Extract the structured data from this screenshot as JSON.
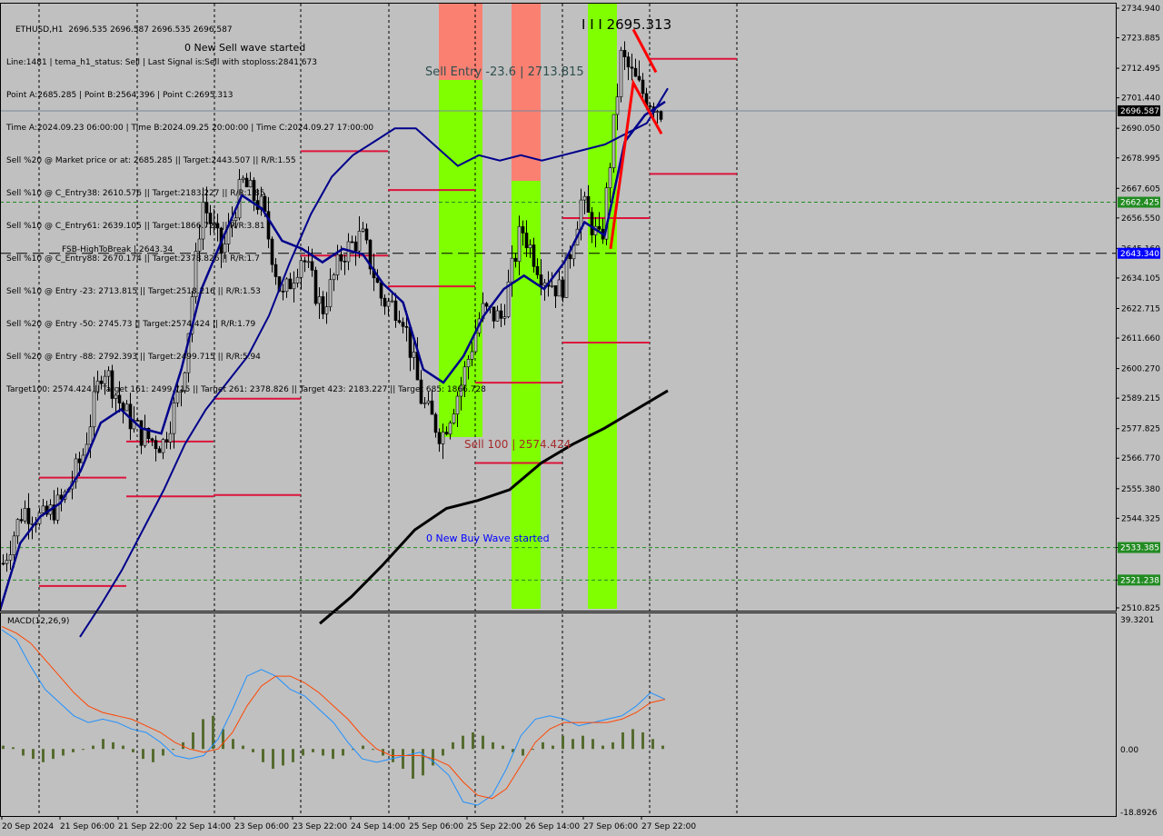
{
  "header": {
    "symbol_line": "ETHUSD,H1  2696.535 2696.587 2696.535 2696.587",
    "info_lines": [
      "Line:1481 | tema_h1_status: Sell | Last Signal is:Sell with stoploss:2841.673",
      "Point A:2685.285 | Point B:2564.396 | Point C:2695.313",
      "Time A:2024.09.23 06:00:00 | Time B:2024.09.25 20:00:00 | Time C:2024.09.27 17:00:00",
      "Sell %20 @ Market price or at: 2685.285 || Target:2443.507 || R/R:1.55",
      "Sell %10 @ C_Entry38: 2610.576 || Target:2183.227 || R/R:1.85",
      "Sell %10 @ C_Entry61: 2639.105 || Target:1866.728 || R/R:3.81",
      "Sell %10 @ C_Entry88: 2670.174 || Target:2378.826 || R/R:1.7",
      "Sell %10 @ Entry -23: 2713.815 || Target:2518.216 || R/R:1.53",
      "Sell %20 @ Entry -50: 2745.73 || Target:2574.424 || R/R:1.79",
      "Sell %20 @ Entry -88: 2792.393 || Target:2499.715 || R/R:5.94",
      "Target100: 2574.424 || Target 161: 2499.715 || Target 261: 2378.826 || Target 423: 2183.227 || Target 685: 1866.728"
    ]
  },
  "annotations": {
    "sell_wave": "0 New Sell wave started",
    "sell_entry": "Sell Entry -23.6 | 2713.815",
    "point_c": "I I I 2695.313",
    "fsb": "FSB-HighToBreak | 2643.34",
    "sell_100": "Sell 100 | 2574.424",
    "buy_wave": "0 New Buy Wave started"
  },
  "colors": {
    "background": "#c0c0c0",
    "sell_zone": "#fa8072",
    "buy_zone": "#7fff00",
    "ma_fast": "#00008b",
    "ma_slow": "#000000",
    "level": "#dc143c",
    "channel": "#ff4500",
    "macd_hist": "#556b2f",
    "macd_main": "#1e90ff",
    "macd_signal": "#ff4500",
    "price_tag": "#000000",
    "green_tag": "#228b22",
    "blue_tag": "#0000ff"
  },
  "chart_data": {
    "type": "candlestick",
    "symbol": "ETHUSD",
    "timeframe": "H1",
    "price_axis": {
      "ylim": [
        2510.825,
        2734.94
      ],
      "ticks": [
        "2734.940",
        "2723.885",
        "2712.495",
        "2701.440",
        "2690.050",
        "2678.995",
        "2667.605",
        "2656.550",
        "2645.160",
        "2634.105",
        "2622.715",
        "2611.660",
        "2600.270",
        "2589.215",
        "2577.825",
        "2566.770",
        "2555.380",
        "2544.325",
        "2533.385",
        "2521.238",
        "2510.825"
      ]
    },
    "time_axis": {
      "ticks": [
        "20 Sep 2024",
        "21 Sep 06:00",
        "21 Sep 22:00",
        "22 Sep 14:00",
        "23 Sep 06:00",
        "23 Sep 22:00",
        "24 Sep 14:00",
        "25 Sep 06:00",
        "25 Sep 22:00",
        "26 Sep 14:00",
        "27 Sep 06:00",
        "27 Sep 22:00"
      ]
    },
    "price_tags": [
      {
        "value": "2696.587",
        "kind": "current"
      },
      {
        "value": "2662.425",
        "kind": "green"
      },
      {
        "value": "2643.340",
        "kind": "blue"
      },
      {
        "value": "2533.385",
        "kind": "green"
      },
      {
        "value": "2521.238",
        "kind": "green"
      }
    ],
    "approx_close_path": [
      2527.5,
      2547.8,
      2544,
      2551,
      2568,
      2602,
      2585,
      2575,
      2572,
      2595,
      2663,
      2643,
      2670,
      2660,
      2626,
      2643,
      2622,
      2643,
      2650,
      2626,
      2622,
      2588,
      2575,
      2595,
      2622,
      2619,
      2653,
      2636,
      2629,
      2663,
      2646,
      2717,
      2704,
      2696.6
    ],
    "ma_fast": [
      2510,
      2535,
      2545,
      2550,
      2562,
      2580,
      2585,
      2578,
      2576,
      2600,
      2630,
      2648,
      2665,
      2660,
      2648,
      2645,
      2640,
      2645,
      2643,
      2632,
      2625,
      2600,
      2595,
      2605,
      2620,
      2630,
      2635,
      2630,
      2640,
      2655,
      2650,
      2685,
      2695,
      2700
    ],
    "ma_mid": [
      2500,
      2512,
      2525,
      2540,
      2555,
      2572,
      2585,
      2595,
      2605,
      2620,
      2640,
      2658,
      2672,
      2680,
      2685,
      2690,
      2690,
      2683,
      2676,
      2680,
      2678,
      2680,
      2678,
      2680,
      2682,
      2684,
      2688,
      2692,
      2705
    ],
    "ma_slow": [
      2505,
      2515,
      2527,
      2540,
      2548,
      2551,
      2555,
      2565,
      2572,
      2578,
      2585,
      2592
    ],
    "macd": {
      "ylim": [
        -18.8926,
        39.3201
      ],
      "ticks": [
        "39.3201",
        "0.00",
        "-18.8926"
      ],
      "label": "MACD(12,26,9)",
      "histogram": [
        1,
        0.5,
        -2,
        -3,
        -4,
        -3,
        -2,
        -1,
        0,
        1,
        3,
        2,
        1,
        -1,
        -3,
        -4,
        -2,
        0,
        2,
        5,
        9,
        10,
        6,
        3,
        1,
        -1,
        -4,
        -6,
        -5,
        -4,
        -2,
        -1,
        -2,
        -3,
        -2,
        0,
        1,
        0,
        -2,
        -4,
        -6,
        -9,
        -8,
        -5,
        -2,
        2,
        4,
        5,
        4,
        2,
        1,
        -1,
        -2,
        0,
        2,
        1,
        4,
        3,
        4,
        3,
        1,
        2,
        5,
        6,
        5,
        3,
        1
      ],
      "main": [
        36,
        33,
        25,
        18,
        14,
        10,
        8,
        9,
        8,
        6,
        5,
        2,
        -2,
        -3,
        -2,
        3,
        12,
        22,
        24,
        22,
        18,
        16,
        12,
        8,
        2,
        -3,
        -4,
        -3,
        -2,
        -1,
        -4,
        -8,
        -16,
        -17,
        -14,
        -6,
        4,
        9,
        10,
        9,
        7,
        8,
        9,
        10,
        13,
        17,
        15
      ],
      "signal": [
        37,
        35,
        32,
        27,
        22,
        17,
        13,
        11,
        10,
        9,
        7,
        5,
        2,
        0,
        -1,
        0,
        5,
        13,
        19,
        22,
        22,
        20,
        17,
        13,
        9,
        4,
        0,
        -2,
        -2,
        -2,
        -3,
        -5,
        -10,
        -14,
        -15,
        -12,
        -5,
        2,
        6,
        8,
        8,
        8,
        8,
        9,
        11,
        14,
        15
      ]
    }
  }
}
